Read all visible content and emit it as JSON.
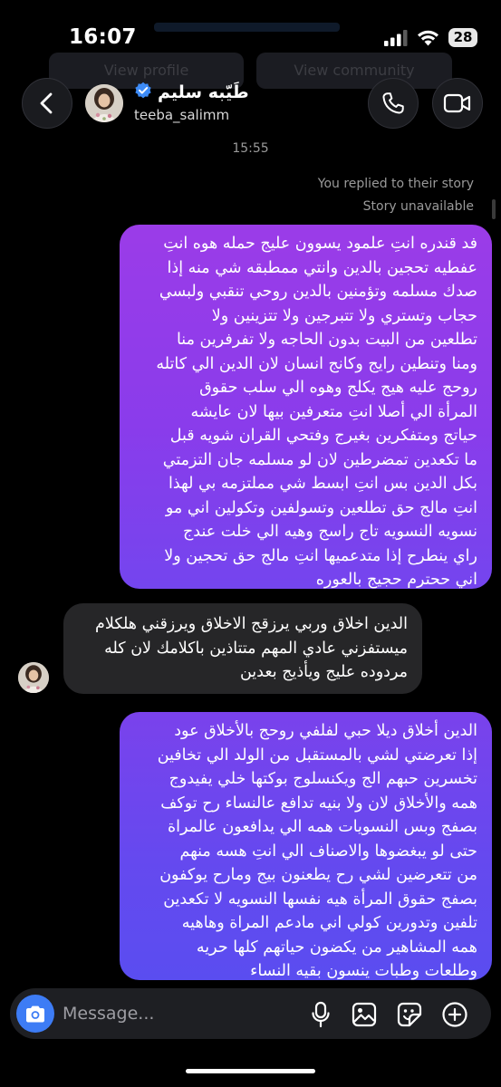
{
  "status_bar": {
    "time": "16:07",
    "battery": "28"
  },
  "background": {
    "view_profile": "View profile",
    "view_community": "View community"
  },
  "contact": {
    "name": "طَيّبه سليم",
    "handle": "teeba_salimm",
    "verified": true
  },
  "thread": {
    "timestamp": "15:55",
    "reply_note": "You replied to their story",
    "story_status": "Story unavailable"
  },
  "messages": [
    {
      "direction": "outgoing",
      "lines": [
        "فد قندره انتِ علمود يسوون عليج حمله هوه انتِ",
        "عفطيه تحجين بالدين وانتي ممطبقه شي منه إذا",
        "صدك مسلمه وتؤمنين بالدين روحي تنقبي ولبسي",
        "حجاب وتستري ولا تتبرجين ولا تتزينين ولا",
        "تطلعين من البيت بدون الحاجه ولا تفرفرين منا",
        "ومنا وتنطين رايج وكانج انسان لان الدين الي كاتله",
        "روحج عليه هيج يكلج وهوه الي سلب حقوق",
        "المرأة الي أصلا انتِ متعرفين بيها لان عايشه",
        "حياتج ومتفكرين بغيرج وفتحي القران شويه قبل",
        "ما تكعدين تمضرطين لان لو مسلمه جان التزمتي",
        "بكل الدين بس انتِ ابسط شي مملتزمه بي لهذا",
        "انتِ مالج حق تطلعين وتسولفين وتكولين اني مو",
        "نسويه النسويه تاج راسج وهيه الي خلت عندج",
        "راي ينطرح إذا متدعميها انتِ مالج حق تحجين ولا",
        "اني ححترم حجيج بالعوره"
      ]
    },
    {
      "direction": "incoming",
      "lines": [
        "الدين اخلاق وربي يرزقج الاخلاق ويرزقني هلكلام",
        "ميستفزني عادي المهم متتاذين باكلامك لان كله",
        "مردوده عليج ويأذيج بعدين"
      ]
    },
    {
      "direction": "outgoing",
      "lines": [
        "الدين أخلاق ديلا حبي لفلفي روحج بالأخلاق عود",
        "إذا تعرضتي لشي بالمستقبل من الولد الي تخافين",
        "تخسرين حبهم الج ويكنسلوج بوكتها خلي يفيدوج",
        "همه والأخلاق لان ولا بنيه تدافع عالنساء رح توكف",
        "بصفج وبس النسويات همه الي يدافعون عالمراة",
        "حتى لو يبغضوها والاصناف الي انتِ هسه منهم",
        "من تتعرضين لشي رح يطعنون بيج ومارح يوكفون",
        "بصفج حقوق المرأة هيه نفسها النسويه لا تكعدين",
        "تلفين وتدورين كولي اني مادعم المراة وهاهيه",
        "همه المشاهير من يكضون حياتهم كلها حريه",
        "وطلعات وطبات ينسون بقيه النساء"
      ]
    }
  ],
  "composer": {
    "placeholder": "Message..."
  },
  "colors": {
    "accent_blue": "#3d7cf5",
    "bubble_grad_top": "#9b3ce8",
    "bubble_grad_bottom": "#5a4df0",
    "incoming_bubble": "#262628"
  },
  "icons": {
    "back": "chevron-left-icon",
    "call": "phone-icon",
    "video": "video-camera-icon",
    "camera": "camera-icon",
    "mic": "microphone-icon",
    "gallery": "image-icon",
    "sticker": "sticker-icon",
    "plus": "plus-circle-icon",
    "verified": "verified-badge-icon"
  }
}
